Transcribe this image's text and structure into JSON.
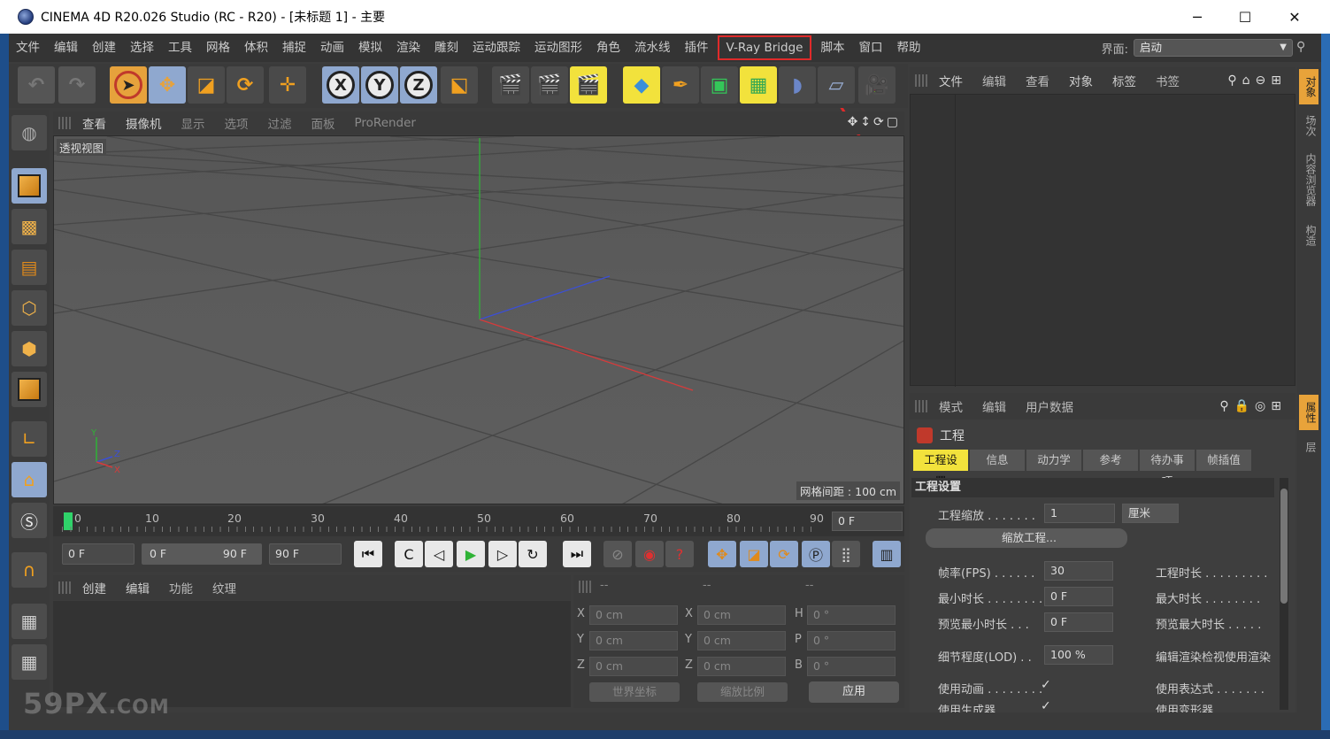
{
  "window": {
    "title": "CINEMA 4D R20.026 Studio (RC - R20) - [未标题 1] - 主要",
    "minimize": "─",
    "maximize": "☐",
    "close": "✕"
  },
  "menubar": {
    "items": [
      "文件",
      "编辑",
      "创建",
      "选择",
      "工具",
      "网格",
      "体积",
      "捕捉",
      "动画",
      "模拟",
      "渲染",
      "雕刻",
      "运动跟踪",
      "运动图形",
      "角色",
      "流水线",
      "插件",
      "V-Ray Bridge",
      "脚本",
      "窗口",
      "帮助"
    ],
    "layout_label": "界面:",
    "layout_value": "启动",
    "highlight_color": "#e02a2a"
  },
  "toolbar": {
    "axis_labels": [
      "X",
      "Y",
      "Z"
    ]
  },
  "viewport": {
    "menu": [
      "查看",
      "摄像机",
      "显示",
      "选项",
      "过滤",
      "面板",
      "ProRender"
    ],
    "view_name": "透视视图",
    "grid_spacing": "网格间距 : 100 cm",
    "axis_y": "Y",
    "axis_z": "Z",
    "axis_x": "X"
  },
  "timeline": {
    "ticks": [
      "0",
      "10",
      "20",
      "30",
      "40",
      "50",
      "60",
      "70",
      "80",
      "90"
    ],
    "current_frame": "0 F"
  },
  "transport": {
    "start_frame": "0 F",
    "range_start": "0 F",
    "range_end": "90 F",
    "end_frame": "90 F"
  },
  "material_manager": {
    "menu": [
      "创建",
      "编辑",
      "功能",
      "纹理"
    ]
  },
  "coordinates": {
    "header": [
      "--",
      "--",
      "--"
    ],
    "rows": [
      {
        "axis": "X",
        "pos": "0 cm",
        "axis2": "X",
        "size": "0 cm",
        "axis3": "H",
        "rot": "0 °"
      },
      {
        "axis": "Y",
        "pos": "0 cm",
        "axis2": "Y",
        "size": "0 cm",
        "axis3": "P",
        "rot": "0 °"
      },
      {
        "axis": "Z",
        "pos": "0 cm",
        "axis2": "Z",
        "size": "0 cm",
        "axis3": "B",
        "rot": "0 °"
      }
    ],
    "world_coord": "世界坐标",
    "scale_ratio": "缩放比例",
    "apply": "应用"
  },
  "object_manager": {
    "menu": [
      "文件",
      "编辑",
      "查看",
      "对象",
      "标签",
      "书签"
    ]
  },
  "right_tabs": [
    "对象",
    "场次",
    "内容浏览器",
    "构造",
    "属性",
    "层"
  ],
  "attribute_manager": {
    "menu": [
      "模式",
      "编辑",
      "用户数据"
    ],
    "title": "工程",
    "tabs": [
      "工程设置",
      "信息",
      "动力学",
      "参考",
      "待办事项",
      "帧插值"
    ],
    "section": "工程设置",
    "scale_label": "工程缩放 . . . . . . .",
    "scale_value": "1",
    "scale_unit": "厘米",
    "scale_button": "缩放工程...",
    "fps_label": "帧率(FPS) . . . . . .",
    "fps_value": "30",
    "project_length_label": "工程时长 . . . . . . . . .",
    "min_time_label": "最小时长 . . . . . . . .",
    "min_time_value": "0 F",
    "max_time_label": "最大时长 . . . . . . . .",
    "preview_min_label": "预览最小时长 . . .",
    "preview_min_value": "0 F",
    "preview_max_label": "预览最大时长 . . . . .",
    "lod_label": "细节程度(LOD) . .",
    "lod_value": "100 %",
    "render_lod_label": "编辑渲染检视使用渲染",
    "use_anim_label": "使用动画 . . . . . . . .",
    "use_anim_check": "✓",
    "use_expr_label": "使用表达式 . . . . . . .",
    "use_gen_label": "使用生成器",
    "use_gen_check": "✓",
    "use_deform_label": "使用变形器"
  },
  "watermark": {
    "main": "59PX",
    "suffix": ".COM"
  }
}
